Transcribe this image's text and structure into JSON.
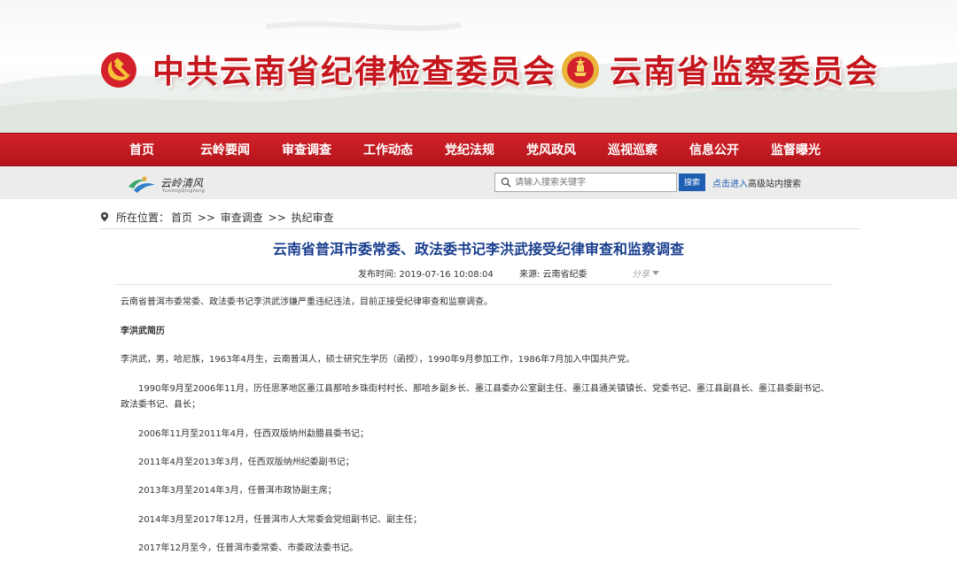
{
  "header": {
    "title_left": "中共云南省纪律检查委员会",
    "title_right": "云南省监察委员会",
    "colors": {
      "brand_red": "#c4161c",
      "nav_red": "#c41c23",
      "link_blue": "#1e5fb4",
      "title_blue": "#1a3f8f"
    }
  },
  "nav": {
    "items": [
      "首页",
      "云岭要闻",
      "审查调查",
      "工作动态",
      "党纪法规",
      "党风政风",
      "巡视巡察",
      "信息公开",
      "监督曝光"
    ]
  },
  "subbar": {
    "logo_text": "云岭清风",
    "logo_sub": "YunlingQingfeng",
    "search_placeholder": "请输入搜索关键字",
    "search_button": "搜索",
    "adv_link_blue": "点击进入",
    "adv_link_rest": "高级站内搜索"
  },
  "breadcrumb": {
    "prefix": "所在位置：",
    "items": [
      "首页",
      "审查调查",
      "执纪审查"
    ],
    "separator": ">>"
  },
  "article": {
    "title": "云南省普洱市委常委、政法委书记李洪武接受纪律审查和监察调查",
    "publish_time": "发布时间: 2019-07-16 10:08:04",
    "source": "来源: 云南省纪委",
    "share_label": "分享",
    "paragraphs": [
      "云南省普洱市委常委、政法委书记李洪武涉嫌严重违纪违法，目前正接受纪律审查和监察调查。",
      "李洪武简历",
      "李洪武，男，哈尼族，1963年4月生，云南普洱人，硕士研究生学历（函授），1990年9月参加工作，1986年7月加入中国共产党。",
      "1990年9月至2006年11月，历任思茅地区墨江县那哈乡珠街村村长、那哈乡副乡长、墨江县委办公室副主任、墨江县通关镇镇长、党委书记、墨江县副县长、墨江县委副书记、政法委书记、县长；",
      "2006年11月至2011年4月，任西双版纳州勐腊县委书记；",
      "2011年4月至2013年3月，任西双版纳州纪委副书记；",
      "2013年3月至2014年3月，任普洱市政协副主席；",
      "2014年3月至2017年12月，任普洱市人大常委会党组副书记、副主任；",
      "2017年12月至今，任普洱市委常委、市委政法委书记。"
    ]
  }
}
